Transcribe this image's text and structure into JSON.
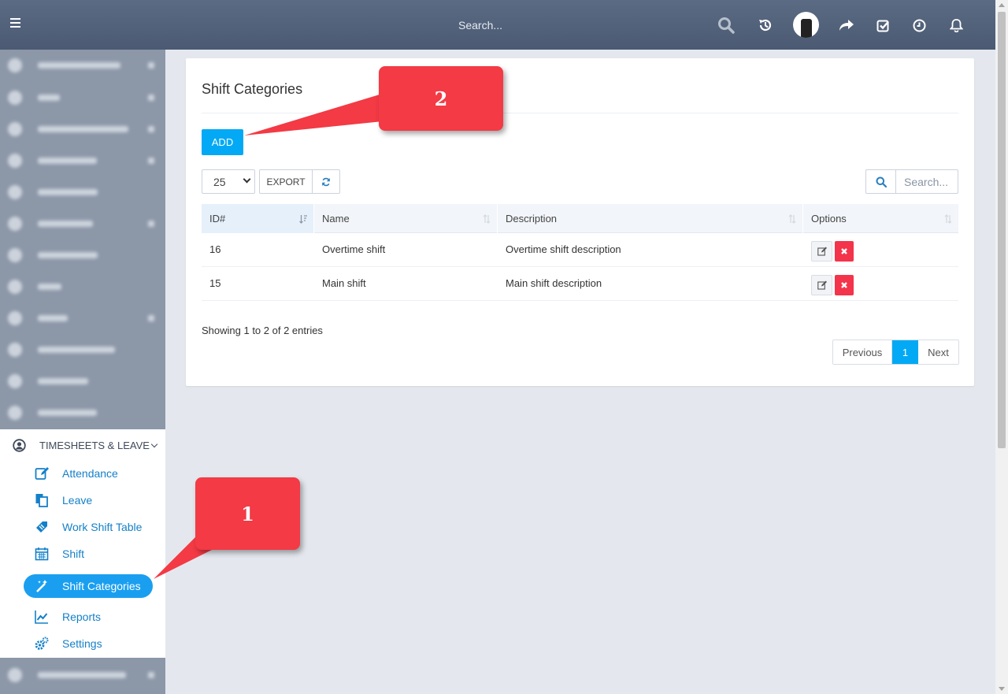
{
  "topbar": {
    "search_placeholder": "Search..."
  },
  "sidebar": {
    "timesheets_label": "TIMESHEETS & LEAVE",
    "submenu": [
      {
        "label": "Attendance",
        "icon": "edit-icon"
      },
      {
        "label": "Leave",
        "icon": "copy-icon"
      },
      {
        "label": "Work Shift Table",
        "icon": "tag-icon"
      },
      {
        "label": "Shift",
        "icon": "calendar-icon"
      },
      {
        "label": "Shift Categories",
        "icon": "magic-wand-icon",
        "active": true
      },
      {
        "label": "Reports",
        "icon": "line-chart-icon"
      },
      {
        "label": "Settings",
        "icon": "gears-icon"
      }
    ]
  },
  "card": {
    "title": "Shift Categories",
    "add_label": "ADD",
    "page_size": "25",
    "export_label": "EXPORT",
    "search_placeholder": "Search...",
    "columns": [
      "ID#",
      "Name",
      "Description",
      "Options"
    ],
    "rows": [
      {
        "id": "16",
        "name": "Overtime shift",
        "description": "Overtime shift description"
      },
      {
        "id": "15",
        "name": "Main shift",
        "description": "Main shift description"
      }
    ],
    "info": "Showing 1 to 2 of 2 entries",
    "pagination": {
      "previous": "Previous",
      "current": "1",
      "next": "Next"
    }
  },
  "callouts": {
    "one": "1",
    "two": "2"
  },
  "colors": {
    "accent": "#03a9f4",
    "danger": "#f3344b",
    "callout": "#f33a45",
    "topbar": "#56657d"
  }
}
